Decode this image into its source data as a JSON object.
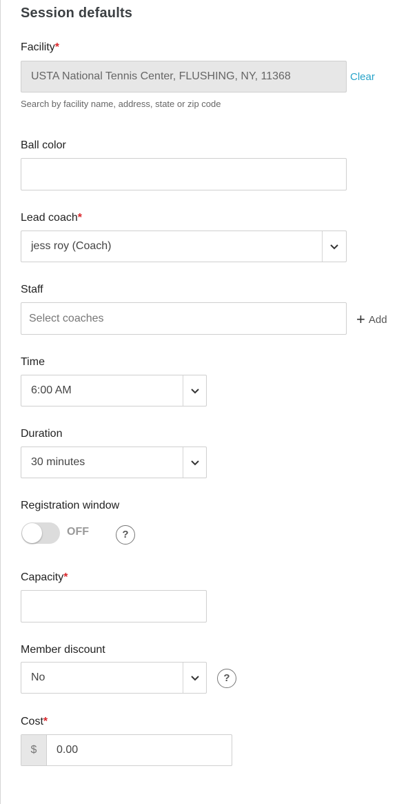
{
  "section": {
    "title": "Session defaults"
  },
  "facility": {
    "label": "Facility",
    "required_mark": "*",
    "value": "USTA National Tennis Center, FLUSHING, NY, 11368",
    "clear_label": "Clear",
    "hint": "Search by facility name, address, state or zip code"
  },
  "ball_color": {
    "label": "Ball color",
    "value": ""
  },
  "lead_coach": {
    "label": "Lead coach",
    "required_mark": "*",
    "value": "jess roy (Coach)"
  },
  "staff": {
    "label": "Staff",
    "placeholder": "Select coaches",
    "add_label": "Add"
  },
  "time": {
    "label": "Time",
    "value": "6:00 AM"
  },
  "duration": {
    "label": "Duration",
    "value": "30 minutes"
  },
  "registration_window": {
    "label": "Registration window",
    "state_label": "OFF",
    "enabled": false,
    "help": "?"
  },
  "capacity": {
    "label": "Capacity",
    "required_mark": "*",
    "value": ""
  },
  "member_discount": {
    "label": "Member discount",
    "value": "No",
    "help": "?"
  },
  "cost": {
    "label": "Cost",
    "required_mark": "*",
    "currency": "$",
    "value": "0.00"
  },
  "icons": {
    "select_arrow": "chevron-down-icon",
    "add": "plus-icon",
    "help": "question-circle-icon"
  },
  "colors": {
    "link": "#27a3c9",
    "required": "#d9262b",
    "disabled_bg": "#e7e7e7"
  }
}
